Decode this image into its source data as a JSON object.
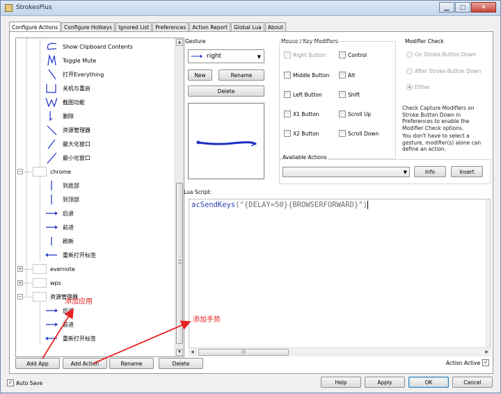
{
  "window": {
    "title": "StrokesPlus"
  },
  "tabs": [
    "Configure Actions",
    "Configure Hotkeys",
    "Ignored List",
    "Preferences",
    "Action Report",
    "Global Lua",
    "About"
  ],
  "tree": {
    "items": [
      {
        "label": "Show Clipboard Contents",
        "icon": "arc-gesture-icon"
      },
      {
        "label": "Toggle Mute",
        "icon": "m-gesture-icon"
      },
      {
        "label": "打开Everything",
        "icon": "diagonal-down-gesture-icon"
      },
      {
        "label": "关机与重启",
        "icon": "square-hook-gesture-icon"
      },
      {
        "label": "截图功能",
        "icon": "w-gesture-icon"
      },
      {
        "label": "删除",
        "icon": "tick-gesture-icon"
      },
      {
        "label": "资源管理器",
        "icon": "backslash-gesture-icon"
      },
      {
        "label": "最大化窗口",
        "icon": "diagonal-up-gesture-icon"
      },
      {
        "label": "最小化窗口",
        "icon": "diagonal-up-long-gesture-icon"
      }
    ],
    "chrome": {
      "label": "chrome",
      "children": [
        {
          "label": "到底部",
          "icon": "down-gesture-icon"
        },
        {
          "label": "到顶部",
          "icon": "up-gesture-icon"
        },
        {
          "label": "后退",
          "icon": "right-gesture-icon"
        },
        {
          "label": "前进",
          "icon": "right-gesture-icon"
        },
        {
          "label": "刷新",
          "icon": "up-small-gesture-icon"
        },
        {
          "label": "重新打开标签",
          "icon": "left-gesture-icon"
        }
      ]
    },
    "apps": [
      "evernote",
      "wps"
    ],
    "explorer": {
      "label": "资源管理器",
      "children": [
        {
          "label": "后退",
          "icon": "right-gesture-icon"
        },
        {
          "label": "前进",
          "icon": "right-gesture-icon"
        },
        {
          "label": "重新打开标签",
          "icon": "left-gesture-icon"
        }
      ]
    }
  },
  "tree_buttons": {
    "add_app": "Add App",
    "add_action": "Add Action",
    "rename": "Rename",
    "delete": "Delete"
  },
  "gesture": {
    "label": "Gesture",
    "selected": "right",
    "new_label": "New",
    "rename_label": "Rename",
    "delete_label": "Delete"
  },
  "modifiers": {
    "label": "Mouse / Key Modifiers",
    "items": [
      {
        "label": "Right Button",
        "disabled": true
      },
      {
        "label": "Control",
        "disabled": false
      },
      {
        "label": "Middle Button",
        "disabled": false
      },
      {
        "label": "Alt",
        "disabled": false
      },
      {
        "label": "Left Button",
        "disabled": false
      },
      {
        "label": "Shift",
        "disabled": false
      },
      {
        "label": "X1 Button",
        "disabled": false
      },
      {
        "label": "Scroll Up",
        "disabled": false
      },
      {
        "label": "X2 Button",
        "disabled": false
      },
      {
        "label": "Scroll Down",
        "disabled": false
      }
    ]
  },
  "modifier_check": {
    "label": "Modifier Check",
    "options": [
      "On Stroke Button Down",
      "After Stroke Button Down",
      "Either"
    ],
    "selected": "Either",
    "note1": "Check Capture Modifiers on Stroke Button Down in Preferences to enable the Modifier Check options.",
    "note2": "You don't have to select a gesture, modifier(s) alone can define an action."
  },
  "available_actions": {
    "label": "Available Actions",
    "value": "",
    "info_label": "Info",
    "insert_label": "Insert"
  },
  "lua": {
    "label": "Lua Script:",
    "code_fn": "acSendKeys",
    "code_args": "(\"{DELAY=50}{BROWSERFORWARD}\")"
  },
  "annotations": {
    "add_app": "添加应用",
    "add_gesture": "添加手势"
  },
  "footer": {
    "action_active_label": "Action Active",
    "auto_save_label": "Auto Save",
    "help_label": "Help",
    "apply_label": "Apply",
    "ok_label": "OK",
    "cancel_label": "Cancel"
  },
  "colors": {
    "gesture_stroke": "#1830c8",
    "annotation": "#e62222",
    "selection": "#3399ff"
  }
}
